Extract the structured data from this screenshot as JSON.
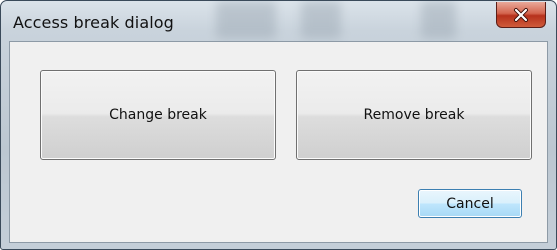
{
  "window": {
    "title": "Access break dialog",
    "close_icon": "close-icon"
  },
  "buttons": {
    "change_break": "Change break",
    "remove_break": "Remove break",
    "cancel": "Cancel"
  },
  "colors": {
    "close_button": "#c9452b",
    "cancel_accent": "#3c7fb1",
    "dialog_background": "#f0f0f0"
  }
}
